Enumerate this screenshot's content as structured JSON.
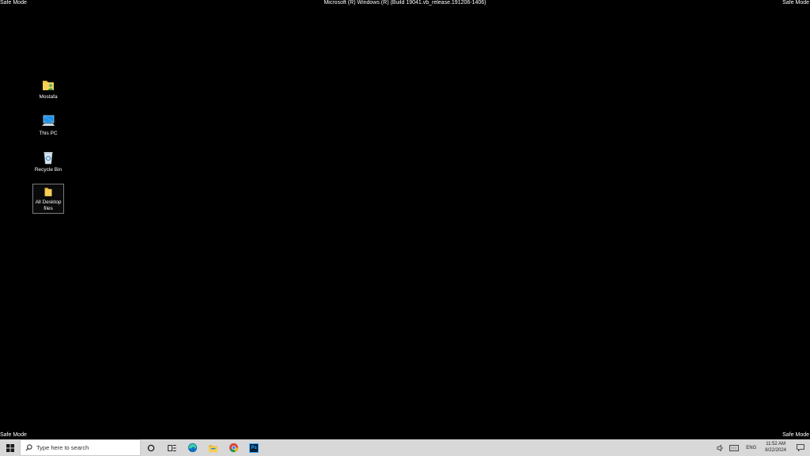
{
  "overlay": {
    "safe_mode_top_left": "Safe Mode",
    "safe_mode_top_right": "Safe Mode",
    "safe_mode_bottom_left": "Safe Mode",
    "safe_mode_bottom_right": "Safe Mode",
    "build_banner": "Microsoft (R) Windows (R) (Build 19041.vb_release.191206-1406)"
  },
  "desktop": {
    "icons": [
      {
        "label": "Mostafa",
        "icon": "user-folder-icon"
      },
      {
        "label": "This PC",
        "icon": "this-pc-icon"
      },
      {
        "label": "Recycle Bin",
        "icon": "recycle-bin-icon"
      },
      {
        "label": "All Desktop files",
        "icon": "folder-icon",
        "selected": true
      }
    ]
  },
  "taskbar": {
    "search_placeholder": "Type here to search",
    "pinned": [
      {
        "name": "cortana",
        "icon": "cortana-icon"
      },
      {
        "name": "task-view",
        "icon": "task-view-icon"
      },
      {
        "name": "edge",
        "icon": "edge-icon"
      },
      {
        "name": "file-explorer",
        "icon": "file-explorer-icon"
      },
      {
        "name": "chrome",
        "icon": "chrome-icon"
      },
      {
        "name": "photoshop",
        "icon": "photoshop-icon",
        "text": "Ps"
      }
    ],
    "tray": {
      "language": "ENG",
      "time": "11:52 AM",
      "date": "8/22/2024"
    }
  },
  "colors": {
    "desktop_bg": "#000000",
    "taskbar_bg": "#d8d8d8",
    "folder_yellow": "#f6cf57",
    "accent_blue": "#0078d7"
  }
}
